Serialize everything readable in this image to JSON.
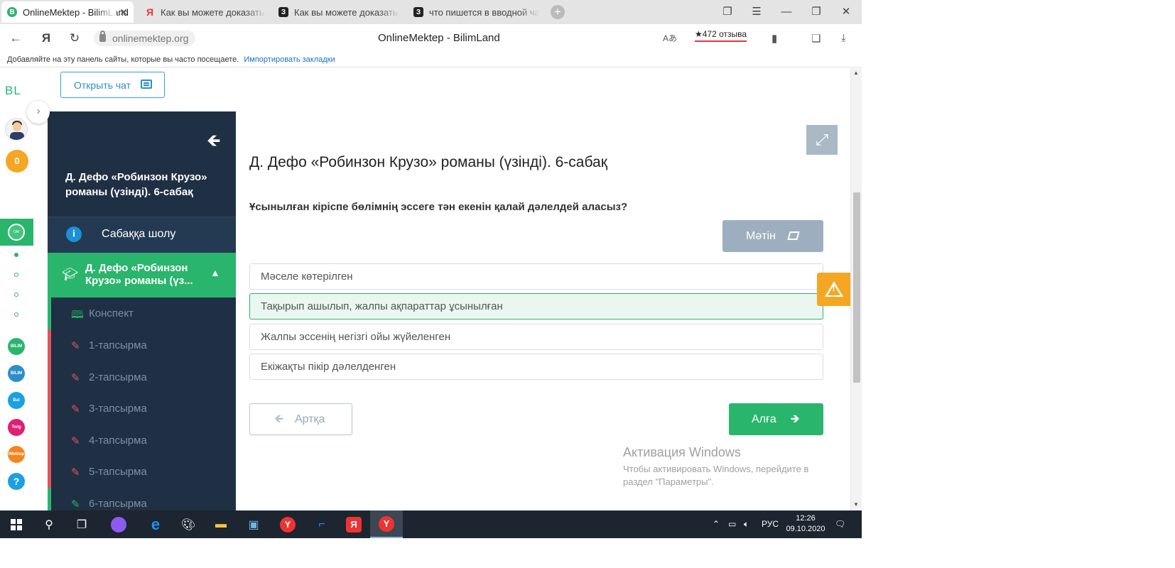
{
  "browser": {
    "tabs": [
      {
        "title": "OnlineMektep - BilimLand",
        "icon_color": "#2ab56d",
        "icon_letter": "B"
      },
      {
        "title": "Как вы можете доказать, ч",
        "icon_color": "#e33",
        "icon_letter": "Я"
      },
      {
        "title": "Как вы можете доказать, ч",
        "icon_color": "#222",
        "icon_letter": "З"
      },
      {
        "title": "что пишется в вводной ча",
        "icon_color": "#222",
        "icon_letter": "З"
      }
    ],
    "url": "onlinemektep.org",
    "page_title": "OnlineMektep - BilimLand",
    "reviews": "★472 отзыва",
    "bookmarks_hint": "Добавляйте на эту панель сайты, которые вы часто посещаете.",
    "bookmarks_import": "Импортировать закладки"
  },
  "rail": {
    "logo": "BL",
    "coins": "0",
    "apps": [
      {
        "label": "BILIM Land",
        "color": "#2ab56d"
      },
      {
        "label": "BILIM Book",
        "color": "#2a8fc9"
      },
      {
        "label": "Bal",
        "color": "#1ba0e2"
      },
      {
        "label": "Twig",
        "color": "#e01e73"
      },
      {
        "label": "iMektep",
        "color": "#f5841f"
      },
      {
        "label": "?",
        "color": "#1ba0e2"
      }
    ]
  },
  "chat": {
    "label": "Открыть чат"
  },
  "lesson": {
    "title": "Д. Дефо «Робинзон Крузо» романы (үзінді). 6-сабақ",
    "overview": "Сабаққа шолу",
    "current": "Д. Дефо «Робинзон Крузо» романы (үз...",
    "items": [
      {
        "label": "Конспект",
        "icon": "book-icon",
        "bar": "#2ab56d",
        "icon_color": "#2ab56d"
      },
      {
        "label": "1-тапсырма",
        "icon": "edit-icon",
        "bar": "#e2525c",
        "icon_color": "#e2525c"
      },
      {
        "label": "2-тапсырма",
        "icon": "edit-icon",
        "bar": "#e2525c",
        "icon_color": "#e2525c"
      },
      {
        "label": "3-тапсырма",
        "icon": "edit-icon",
        "bar": "#e2525c",
        "icon_color": "#e2525c"
      },
      {
        "label": "4-тапсырма",
        "icon": "edit-icon",
        "bar": "#e2525c",
        "icon_color": "#e2525c"
      },
      {
        "label": "5-тапсырма",
        "icon": "edit-icon",
        "bar": "#e2525c",
        "icon_color": "#e2525c"
      },
      {
        "label": "6-тапсырма",
        "icon": "edit-icon",
        "bar": "#2ab56d",
        "icon_color": "#2ab56d"
      }
    ]
  },
  "main": {
    "title": "Д. Дефо «Робинзон Крузо» романы (үзінді). 6-сабақ",
    "question": "Ұсынылған кіріспе бөлімнің эссеге тән екенін қалай дәлелдей аласыз?",
    "text_button": "Мәтін",
    "answers": [
      {
        "label": "Мәселе көтерілген",
        "selected": false
      },
      {
        "label": "Тақырып ашылып, жалпы ақпараттар ұсынылған",
        "selected": true
      },
      {
        "label": "Жалпы эссенің негізгі ойы жүйеленген",
        "selected": false
      },
      {
        "label": "Екіжақты пікір дәлелденген",
        "selected": false
      }
    ],
    "back_label": "Артқа",
    "next_label": "Алға"
  },
  "watermark": {
    "line1": "Активация Windows",
    "line2": "Чтобы активировать Windows, перейдите в",
    "line3": "раздел \"Параметры\"."
  },
  "taskbar": {
    "lang": "РУС",
    "time": "12:26",
    "date": "09.10.2020"
  },
  "colors": {
    "accent_green": "#2ab56d",
    "sidebar_bg": "#1f3044",
    "warning": "#f5a623"
  }
}
